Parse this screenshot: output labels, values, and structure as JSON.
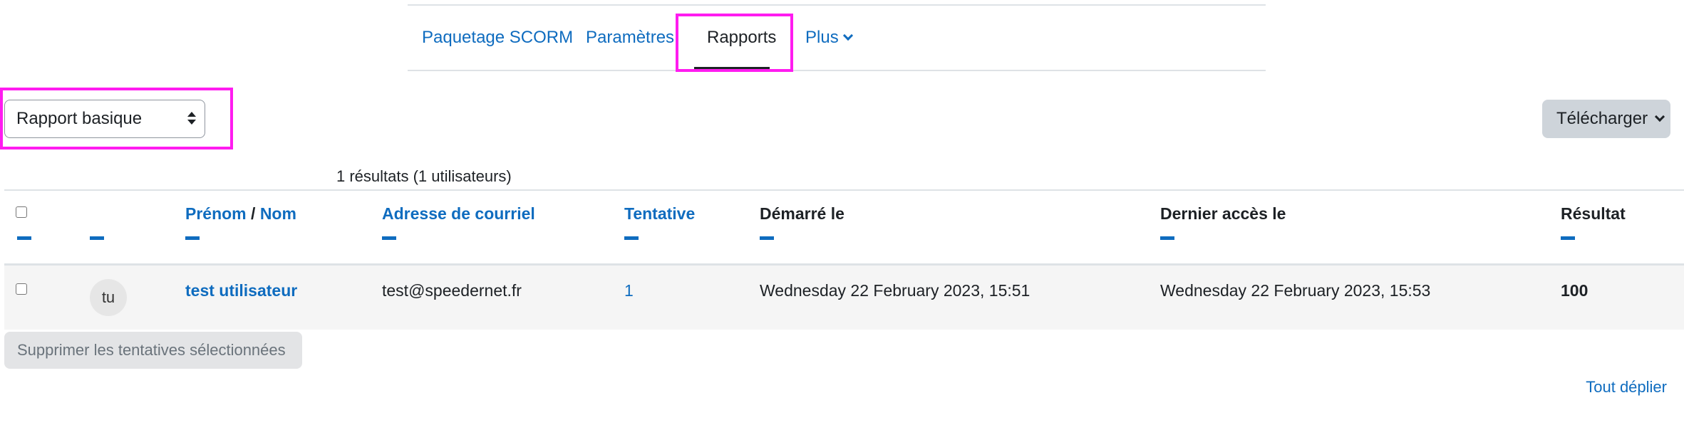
{
  "tabs": [
    {
      "label": "Paquetage SCORM"
    },
    {
      "label": "Paramètres"
    },
    {
      "label": "Rapports"
    },
    {
      "label": "Plus"
    }
  ],
  "report_select": {
    "value": "Rapport basique"
  },
  "download_button": {
    "label": "Télécharger"
  },
  "results_summary": "1 résultats (1 utilisateurs)",
  "table": {
    "headers": {
      "firstname": "Prénom",
      "separator": "/",
      "lastname": "Nom",
      "email": "Adresse de courriel",
      "attempt": "Tentative",
      "started": "Démarré le",
      "last_access": "Dernier accès le",
      "score": "Résultat"
    },
    "rows": [
      {
        "avatar_initials": "tu",
        "name": "test utilisateur",
        "email": "test@speedernet.fr",
        "attempt": "1",
        "started": "Wednesday 22 February 2023, 15:51",
        "last_access": "Wednesday 22 February 2023, 15:53",
        "score": "100"
      }
    ]
  },
  "delete_button": {
    "label": "Supprimer les tentatives sélectionnées"
  },
  "expand_all_link": "Tout déplier",
  "colors": {
    "link": "#0f6cbf",
    "highlight": "#ff1cf0",
    "row_bg": "#f5f5f5"
  },
  "icons": [
    "chevron-down-icon",
    "select-arrows-icon"
  ]
}
